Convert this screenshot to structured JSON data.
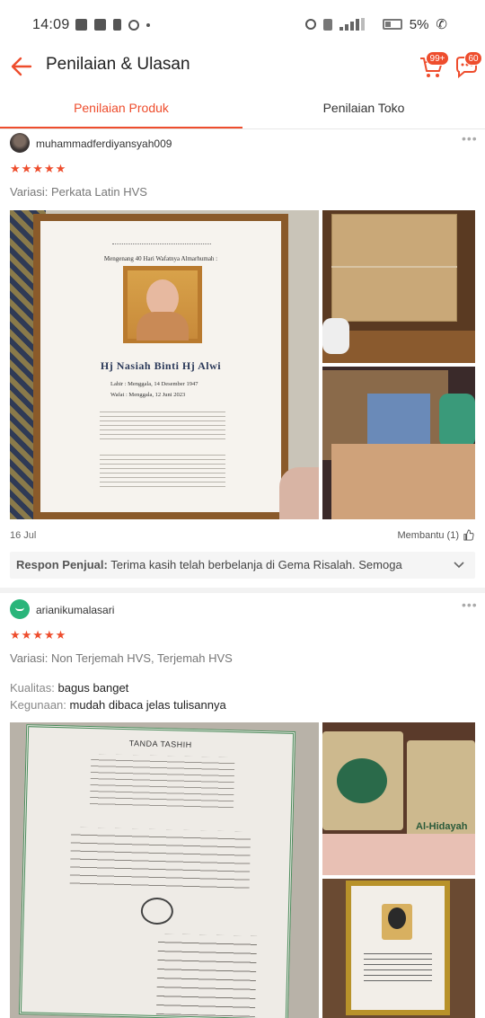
{
  "status_bar": {
    "time": "14:09",
    "battery": "5%"
  },
  "header": {
    "title": "Penilaian & Ulasan",
    "cart_badge": "99+",
    "chat_badge": "60"
  },
  "tabs": [
    {
      "label": "Penilaian Produk",
      "active": true
    },
    {
      "label": "Penilaian Toko",
      "active": false
    }
  ],
  "colors": {
    "accent": "#ee4d2d"
  },
  "reviews": [
    {
      "username": "muhammadferdiyansyah009",
      "stars": "★★★★★",
      "variasi": "Variasi: Perkata Latin HVS",
      "date": "16 Jul",
      "helpful": "Membantu (1)",
      "seller_reply_label": "Respon Penjual:",
      "seller_reply": " Terima kasih telah berbelanja di Gema Risalah. Semoga",
      "photo_text": {
        "title": "Hj Nasiah Binti Hj Alwi",
        "header": "Mengenang 40 Hari Wafatnya Almarhumah :",
        "lahir": "Lahir : Menggala, 14 Desember 1947",
        "wafat": "Wafat : Menggala, 12 Juni 2023"
      }
    },
    {
      "username": "arianikumalasari",
      "stars": "★★★★★",
      "variasi": "Variasi: Non Terjemah HVS, Terjemah HVS",
      "kualitas_key": "Kualitas:",
      "kualitas_val": " bagus banget",
      "kegunaan_key": "Kegunaan:",
      "kegunaan_val": " mudah dibaca jelas tulisannya",
      "photo_text": {
        "tashih": "TANDA TASHIH",
        "box_label": "Al-Hidayah"
      }
    }
  ]
}
